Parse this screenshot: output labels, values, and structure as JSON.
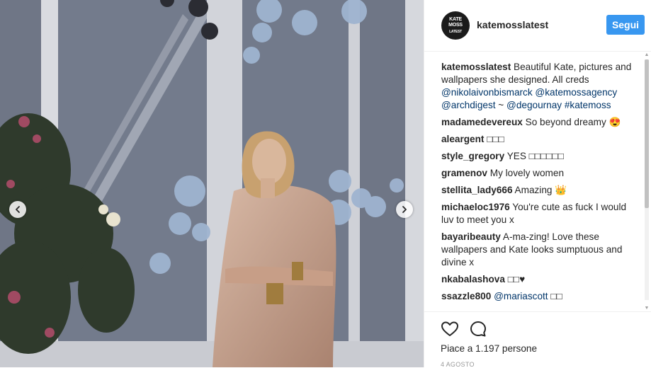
{
  "post": {
    "username": "katemosslatest",
    "avatar_text_line1": "KATE",
    "avatar_text_line2": "MOSS",
    "avatar_text_line3": "LATEST",
    "follow_label": "Segui",
    "caption": {
      "user": "katemosslatest",
      "text": "Beautiful Kate, pictures and wallpapers she designed. All creds",
      "mention1": "@nikolaivonbismarck",
      "mention2": "@katemossagency",
      "mention3": "@archdigest",
      "tilde": " ~ ",
      "mention4": "@degournay",
      "hashtag": "#katemoss"
    },
    "comments": [
      {
        "user": "madamedevereux",
        "text": "So beyond dreamy 😍"
      },
      {
        "user": "aleargent",
        "text": "□□□"
      },
      {
        "user": "style_gregory",
        "text": "YES □□□□□□"
      },
      {
        "user": "gramenov",
        "text": "My lovely women"
      },
      {
        "user": "stellita_lady666",
        "text": "Amazing 👑"
      },
      {
        "user": "michaeloc1976",
        "text": "You're cute as fuck I would luv to meet you x"
      },
      {
        "user": "bayaribeauty",
        "text": "A-ma-zing! Love these wallpapers and Kate looks sumptuous and divine x"
      },
      {
        "user": "nkabalashova",
        "text": "□□♥"
      },
      {
        "user": "ssazzle800",
        "mention": "@mariascott",
        "text": " □□"
      }
    ],
    "likes_text": "Piace a 1.197 persone",
    "date_text": "4 AGOSTO"
  },
  "icons": {
    "like": "heart-icon",
    "comment": "comment-bubble-icon",
    "prev": "chevron-left-icon",
    "next": "chevron-right-icon"
  },
  "colors": {
    "follow_button": "#3897f0",
    "link": "#003569",
    "text": "#262626",
    "muted": "#999999"
  }
}
